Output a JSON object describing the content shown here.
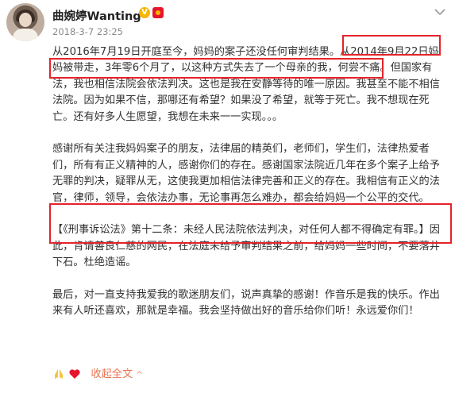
{
  "post": {
    "username": "曲婉婷Wanting",
    "verified_badge": "V",
    "timestamp": "2018-3-7 23:25",
    "paragraphs": [
      "从2016年7月19日开庭至今，妈妈的案子还没任何审判结果。从2014年9月22日妈妈被带走，3年零6个月了，以这种方式失去了一个母亲的我，何尝不痛。但国家有法，我也相信法院会依法判决。这也是我在安静等待的唯一原因。我甚至不能不相信法院。因为如果不信，那哪还有希望？如果没了希望，就等于死亡。我不想现在死亡。还有好多人生愿望，我想在未来一一实现。。。",
      "感谢所有关注我妈妈案子的朋友，法律届的精英们，老师们，学生们，法律热爱者们，所有有正义精神的人，感谢你们的存在。感谢国家法院近几年在多个案子上给予无罪的判决，疑罪从无，这使我更加相信法律完善和正义的存在。我相信有正义的法官，律师，领导，会依法办事，无论事再怎么难办，都会给妈妈一个公平的交代。",
      "【《刑事诉讼法》第十二条：未经人民法院依法判决，对任何人都不得确定有罪。】因此，肯请善良仁慈的网民，在法庭未给予审判结果之前，给妈妈一些时间，不要落井下石。杜绝造谣。",
      "最后，对一直支持我爱我的歌迷朋友们，说声真挚的感谢！作音乐是我的快乐。作出来有人听还喜欢，那就是幸福。我会坚持做出好的音乐给你们听！永远爱你们！"
    ],
    "collapse_label": "收起全文",
    "icons": [
      "avatar",
      "verified-v-icon",
      "weibo-badge-icon",
      "chevron-down-icon",
      "pray-hands-icon",
      "red-heart-icon",
      "caret-up-icon"
    ],
    "colors": {
      "highlight": "#e5232b",
      "link": "#eb7350",
      "text": "#333333",
      "meta": "#8a8a8a"
    }
  }
}
